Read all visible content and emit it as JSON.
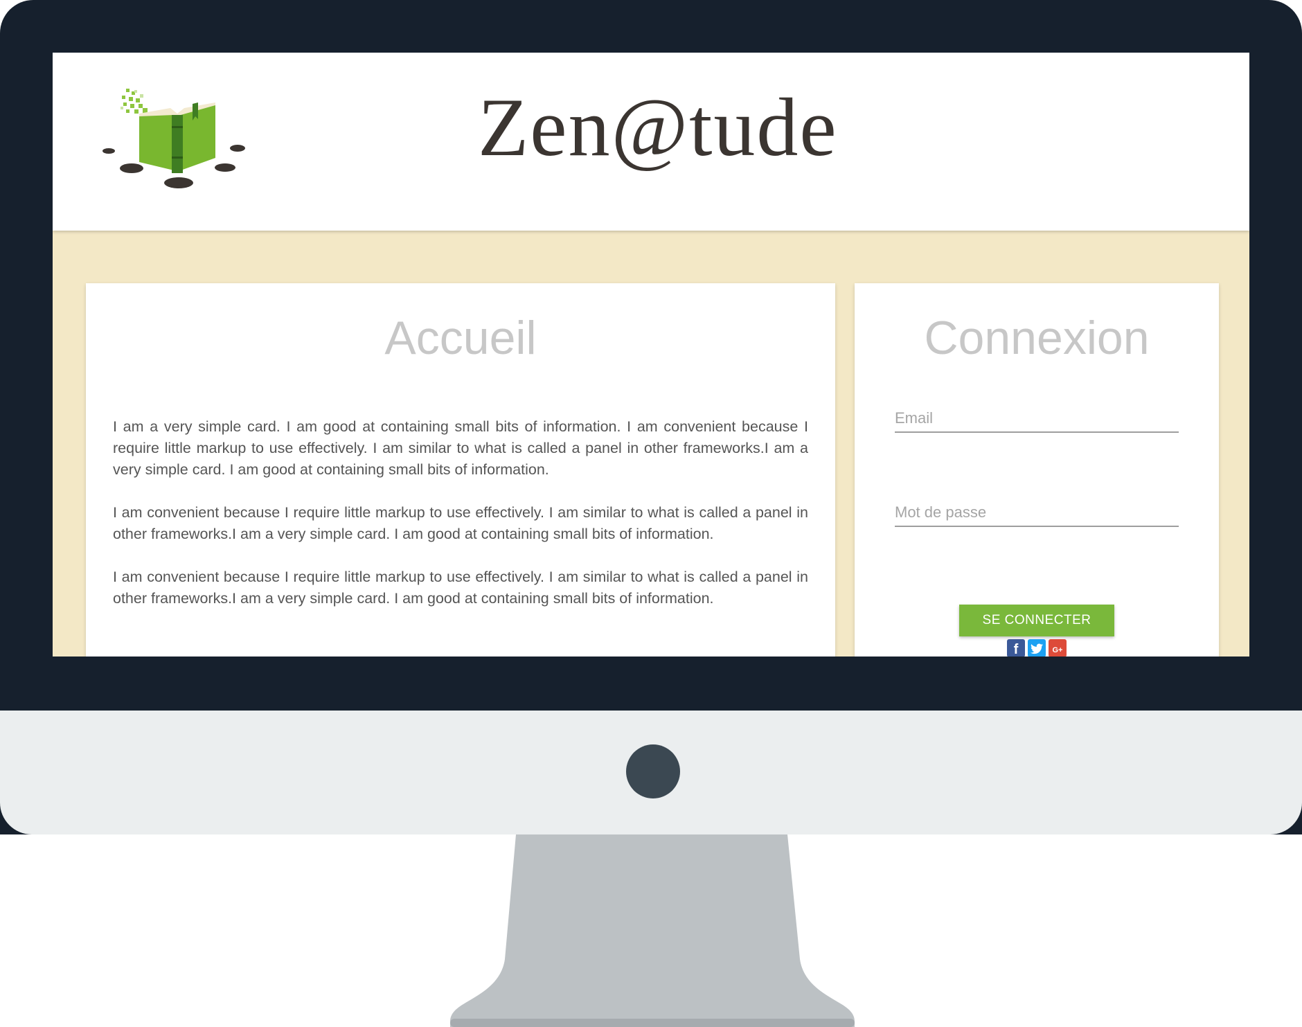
{
  "site": {
    "brand": "Zen@tude"
  },
  "home_card": {
    "title": "Accueil",
    "paragraphs": [
      "I am a very simple card. I am good at containing small bits of information. I am convenient because I require little markup to use effectively. I am similar to what is called a panel in other frameworks.I am a very simple card. I am good at containing small bits of information.",
      "I am convenient because I require little markup to use effectively. I am similar to what is called a panel in other frameworks.I am a very simple card. I am good at containing small bits of information.",
      "I am convenient because I require little markup to use effectively. I am similar to what is called a panel in other frameworks.I am a very simple card. I am good at containing small bits of information."
    ]
  },
  "login_card": {
    "title": "Connexion",
    "email_placeholder": "Email",
    "password_placeholder": "Mot de passe",
    "submit_label": "SE CONNECTER",
    "social": [
      {
        "name": "facebook-icon",
        "glyph": "f",
        "color": "#3b5998"
      },
      {
        "name": "twitter-icon",
        "glyph": "t",
        "color": "#1da1f2"
      },
      {
        "name": "google-plus-icon",
        "glyph": "G+",
        "color": "#dd4b39"
      }
    ]
  },
  "colors": {
    "bezel": "#16202d",
    "chin": "#ebeeef",
    "stand": "#bcc1c4",
    "page_background": "#f3e8c6",
    "accent_green": "#7ab83b",
    "book_green": "#79b72f"
  }
}
